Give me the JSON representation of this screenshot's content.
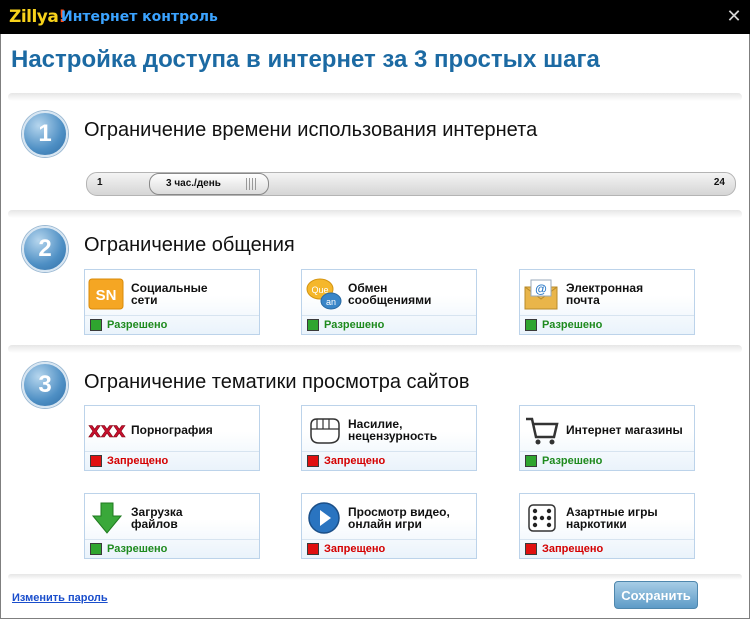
{
  "app": {
    "logo_text": "Zillya",
    "logo_bang": "!",
    "title": "Интернет контроль"
  },
  "heading": "Настройка доступа в интернет за 3 простых шага",
  "step1": {
    "number": "1",
    "title": "Ограничение времени использования интернета",
    "slider": {
      "min_label": "1",
      "max_label": "24",
      "value_label": "3 час./день",
      "value": 3,
      "min": 1,
      "max": 24
    }
  },
  "step2": {
    "number": "2",
    "title": "Ограничение общения",
    "cards": [
      {
        "label": "Социальные\nсети",
        "status": "Разрешено",
        "state": "allowed",
        "icon": "sn-icon",
        "icon_text": "SN"
      },
      {
        "label": "Обмен\nсообщениями",
        "status": "Разрешено",
        "state": "allowed",
        "icon": "chat-icon",
        "icon_text1": "Que",
        "icon_text2": "an"
      },
      {
        "label": "Электронная\nпочта",
        "status": "Разрешено",
        "state": "allowed",
        "icon": "email-icon"
      }
    ]
  },
  "step3": {
    "number": "3",
    "title": "Ограничение тематики просмотра сайтов",
    "cards": [
      {
        "label": "Порнография",
        "status": "Запрещено",
        "state": "blocked",
        "icon": "xxx-icon",
        "icon_text": "XXX"
      },
      {
        "label": "Насилие,\nнецензурность",
        "status": "Запрещено",
        "state": "blocked",
        "icon": "fist-icon"
      },
      {
        "label": "Интернет магазины",
        "status": "Разрешено",
        "state": "allowed",
        "icon": "cart-icon"
      },
      {
        "label": "Загрузка\nфайлов",
        "status": "Разрешено",
        "state": "allowed",
        "icon": "download-icon"
      },
      {
        "label": "Просмотр видео,\nонлайн игри",
        "status": "Запрещено",
        "state": "blocked",
        "icon": "play-icon"
      },
      {
        "label": "Азартные игры\nнаркотики",
        "status": "Запрещено",
        "state": "blocked",
        "icon": "dice-icon"
      }
    ]
  },
  "footer": {
    "change_password": "Изменить пароль",
    "save": "Сохранить"
  },
  "colors": {
    "heading": "#1c6aa3",
    "allowed": "#2fa52f",
    "blocked": "#e01010",
    "logo": "#f7d21b",
    "app_title": "#3ba3ff"
  }
}
